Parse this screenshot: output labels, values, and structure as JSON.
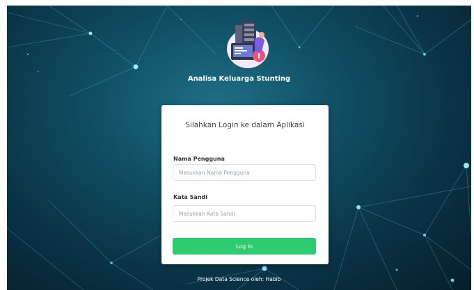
{
  "app": {
    "title": "Analisa Keluarga Stunting",
    "logo_icon": "data-server-info-illustration"
  },
  "login": {
    "heading": "Silahkan Login ke dalam Aplikasi",
    "username_label": "Nama Pengguna",
    "username_placeholder": "Masukkan Nama Pengguna",
    "username_value": "",
    "password_label": "Kata Sandi",
    "password_placeholder": "Masukkan Kata Sandi",
    "password_value": "",
    "submit_label": "Log In"
  },
  "footer": {
    "text": "Projek Data Science oleh: Habib"
  },
  "colors": {
    "background_dark": "#0a3446",
    "background_light": "#1f6f85",
    "button": "#2ecc71",
    "card": "#ffffff",
    "node_glow": "#7fe8ff"
  }
}
